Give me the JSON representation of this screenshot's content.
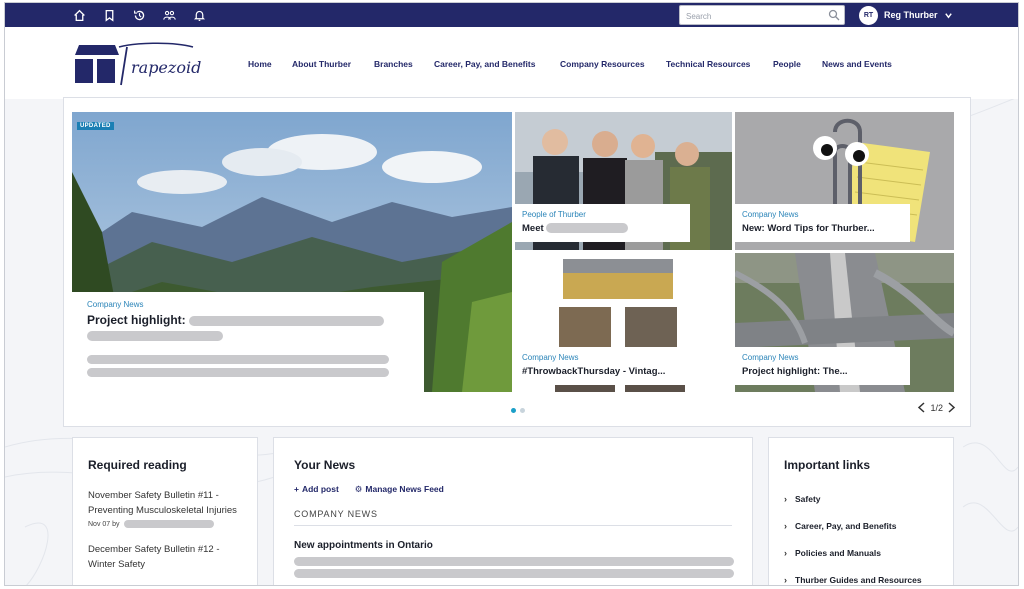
{
  "topbar": {
    "icons": [
      "home-icon",
      "bookmark-icon",
      "history-icon",
      "groups-icon",
      "bell-icon"
    ],
    "search_placeholder": "Search",
    "user_initials": "RT",
    "user_name": "Reg Thurber"
  },
  "brand": {
    "logo_text": "Trapezoid"
  },
  "nav": [
    "Home",
    "About Thurber",
    "Branches",
    "Career, Pay, and Benefits",
    "Company Resources",
    "Technical Resources",
    "People",
    "News and Events"
  ],
  "carousel": {
    "main": {
      "badge": "UPDATED",
      "category": "Company News",
      "title": "Project highlight:"
    },
    "tiles": [
      {
        "category": "People of Thurber",
        "title": "Meet"
      },
      {
        "category": "Company News",
        "title": "New: Word Tips for Thurber..."
      },
      {
        "category": "Company News",
        "title": "#ThrowbackThursday - Vintag..."
      },
      {
        "category": "Company News",
        "title": "Project highlight: The..."
      }
    ],
    "page": "1/2"
  },
  "required_reading": {
    "title": "Required reading",
    "items": [
      {
        "text": "November Safety Bulletin #11 - Preventing Musculoskeletal Injuries",
        "date": "Nov 07 by"
      },
      {
        "text": "December Safety Bulletin #12 - Winter Safety"
      }
    ]
  },
  "your_news": {
    "title": "Your News",
    "add_post": "Add post",
    "manage_feed": "Manage News Feed",
    "section": "COMPANY NEWS",
    "headline": "New appointments in Ontario"
  },
  "important_links": {
    "title": "Important links",
    "items": [
      "Safety",
      "Career, Pay, and Benefits",
      "Policies and Manuals",
      "Thurber Guides and Resources"
    ]
  },
  "colors": {
    "navy": "#232869",
    "accent": "#2a84b8",
    "active_dot": "#1b9fc8"
  }
}
